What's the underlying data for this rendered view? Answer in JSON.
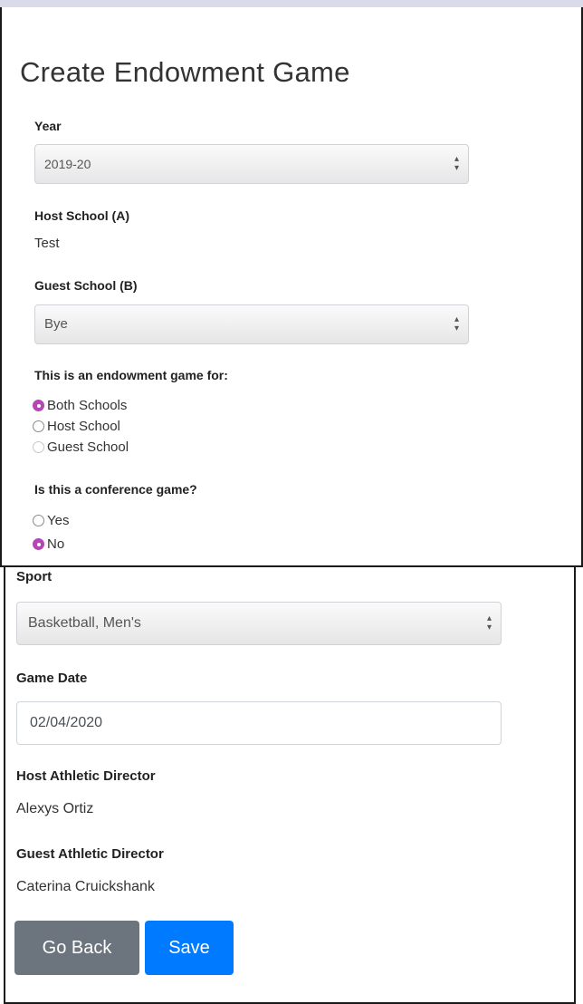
{
  "form": {
    "title": "Create Endowment Game",
    "year": {
      "label": "Year",
      "value": "2019-20"
    },
    "host_school": {
      "label": "Host School (A)",
      "value": "Test"
    },
    "guest_school": {
      "label": "Guest School (B)",
      "value": "Bye"
    },
    "endowment_for": {
      "label": "This is an endowment game for:",
      "options": [
        {
          "label": "Both Schools",
          "checked": true
        },
        {
          "label": "Host School",
          "checked": false
        },
        {
          "label": "Guest School",
          "checked": false
        }
      ]
    },
    "conference": {
      "label": "Is this a conference game?",
      "options": [
        {
          "label": "Yes",
          "checked": false
        },
        {
          "label": "No",
          "checked": true
        }
      ]
    },
    "sport": {
      "label": "Sport",
      "value": "Basketball, Men's"
    },
    "game_date": {
      "label": "Game Date",
      "value": "02/04/2020"
    },
    "host_ad": {
      "label": "Host Athletic Director",
      "value": "Alexys Ortiz"
    },
    "guest_ad": {
      "label": "Guest Athletic Director",
      "value": "Caterina Cruickshank"
    },
    "buttons": {
      "back": "Go Back",
      "save": "Save"
    }
  },
  "colors": {
    "radio_checked": "#b347b3",
    "back_button": "#6c757d",
    "save_button": "#007bff"
  }
}
